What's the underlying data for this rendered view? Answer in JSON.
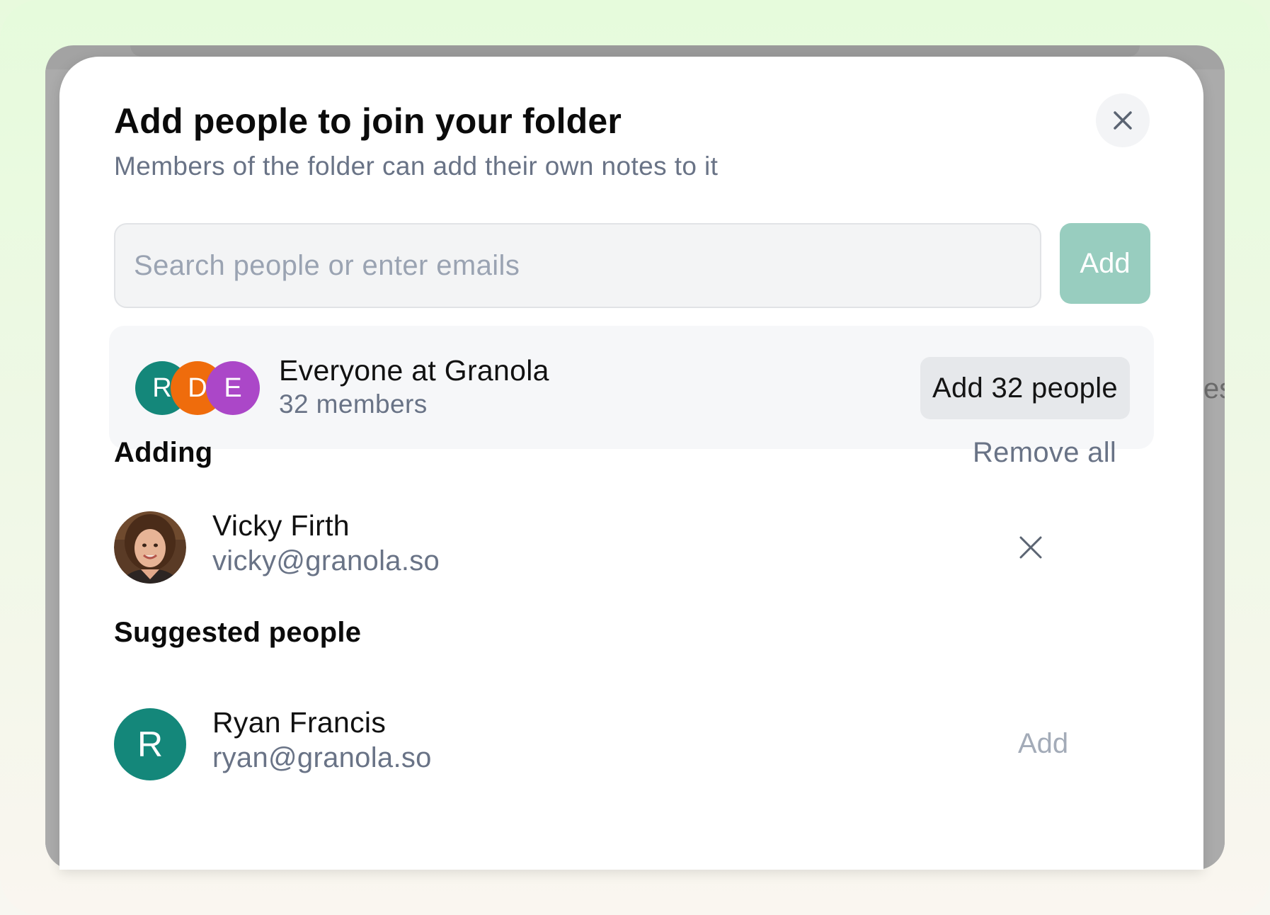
{
  "dialog": {
    "title": "Add people to join your folder",
    "subtitle": "Members of the folder can add their own notes to it",
    "close_icon": "close-icon"
  },
  "search": {
    "placeholder": "Search people or enter emails",
    "value": "",
    "add_label": "Add",
    "add_color": "#98cdbf"
  },
  "everyone": {
    "name": "Everyone at Granola",
    "count": "32 members",
    "add_label": "Add 32 people",
    "avatars": [
      {
        "letter": "R",
        "color": "#14877a"
      },
      {
        "letter": "D",
        "color": "#ef6c0c"
      },
      {
        "letter": "E",
        "color": "#ab47c8"
      }
    ]
  },
  "adding": {
    "heading": "Adding",
    "remove_all_label": "Remove all",
    "people": [
      {
        "name": "Vicky Firth",
        "email": "vicky@granola.so",
        "avatar": "photo"
      }
    ]
  },
  "suggested": {
    "heading": "Suggested people",
    "people": [
      {
        "name": "Ryan Francis",
        "email": "ryan@granola.so",
        "avatar_letter": "R",
        "avatar_color": "#14877a",
        "add_label": "Add"
      }
    ]
  },
  "background": {
    "peek_text": "es"
  }
}
